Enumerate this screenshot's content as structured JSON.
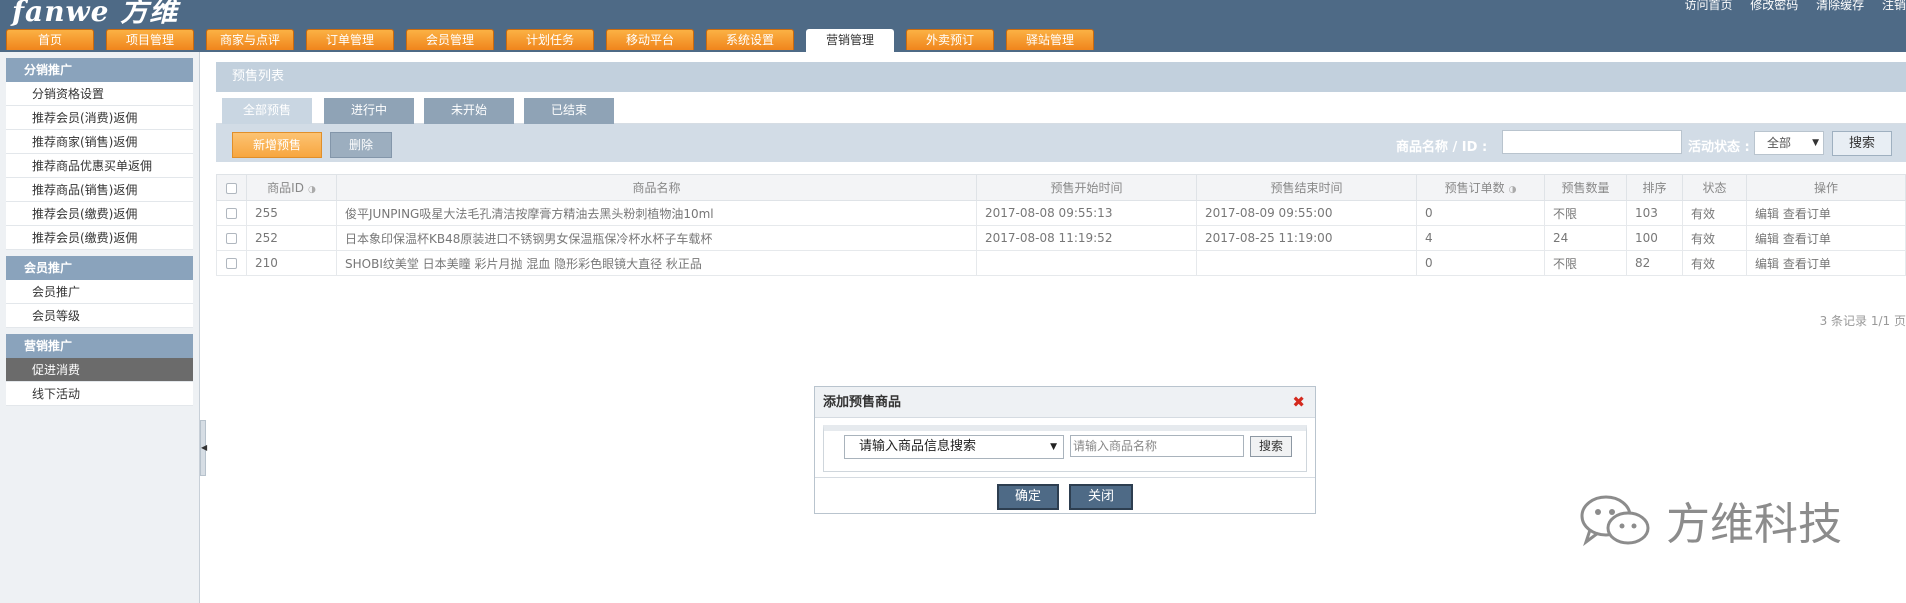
{
  "header": {
    "logo": "fanwe 方维",
    "toplinks": [
      "访问首页",
      "修改密码",
      "清除缓存",
      "注销"
    ],
    "nav_tabs": [
      "首页",
      "项目管理",
      "商家与点评",
      "订单管理",
      "会员管理",
      "计划任务",
      "移动平台",
      "系统设置",
      "营销管理",
      "外卖预订",
      "驿站管理"
    ],
    "active_tab": "营销管理"
  },
  "sidebar": {
    "groups": [
      {
        "title": "分销推广",
        "items": [
          "分销资格设置",
          "推荐会员(消费)返佣",
          "推荐商家(销售)返佣",
          "推荐商品优惠买单返佣",
          "推荐商品(销售)返佣",
          "推荐会员(缴费)返佣",
          "推荐会员(缴费)返佣"
        ]
      },
      {
        "title": "会员推广",
        "items": [
          "会员推广",
          "会员等级"
        ]
      },
      {
        "title": "营销推广",
        "items": [
          "促进消费",
          "线下活动"
        ]
      }
    ],
    "active_item": "促进消费"
  },
  "main": {
    "section_title": "预售列表",
    "subtabs": [
      "全部预售",
      "进行中",
      "未开始",
      "已结束"
    ],
    "toolbar": {
      "add_label": "新增预售",
      "delete_label": "删除",
      "name_id_label": "商品名称 / ID :",
      "status_label": "活动状态 :",
      "status_value": "全部",
      "search_label": "搜索"
    },
    "table": {
      "headers": [
        "商品ID",
        "商品名称",
        "预售开始时间",
        "预售结束时间",
        "预售订单数",
        "预售数量",
        "排序",
        "状态",
        "操作"
      ],
      "rows": [
        {
          "id": "255",
          "name": "俊平JUNPING吸星大法毛孔清洁按摩膏方精油去黑头粉刺植物油10ml",
          "start": "2017-08-08 09:55:13",
          "end": "2017-08-09 09:55:00",
          "orders": "0",
          "qty": "不限",
          "sort": "103",
          "status": "有效",
          "edit": "编辑",
          "view": "查看订单"
        },
        {
          "id": "252",
          "name": "日本象印保温杯KB48原装进口不锈钢男女保温瓶保冷杯水杯子车载杯",
          "start": "2017-08-08 11:19:52",
          "end": "2017-08-25 11:19:00",
          "orders": "4",
          "qty": "24",
          "sort": "100",
          "status": "有效",
          "edit": "编辑",
          "view": "查看订单"
        },
        {
          "id": "210",
          "name": "SHOBI纹美堂 日本美瞳 彩片月抛 混血 隐形彩色眼镜大直径 秋正品",
          "start": "",
          "end": "",
          "orders": "0",
          "qty": "不限",
          "sort": "82",
          "status": "有效",
          "edit": "编辑",
          "view": "查看订单"
        }
      ]
    },
    "pager": "3 条记录 1/1 页"
  },
  "dialog": {
    "title": "添加预售商品",
    "select_value": "请输入商品信息搜索",
    "input_placeholder": "请输入商品名称",
    "search_label": "搜索",
    "confirm_label": "确定",
    "close_label": "关闭"
  },
  "watermark": "方维科技",
  "colors": {
    "header_bg": "#4e6a86",
    "nav_orange": "#f0851c",
    "sidebar_head": "#8aa3bc",
    "close_red": "#d42a1e"
  }
}
